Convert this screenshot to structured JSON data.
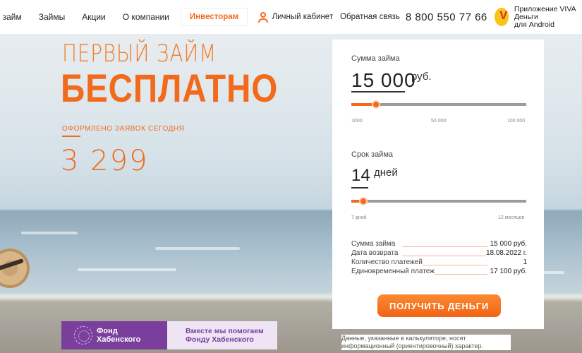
{
  "nav": {
    "items": [
      "ь займ",
      "Займы",
      "Акции",
      "О компании"
    ],
    "investors": "Инвесторам",
    "cabinet": "Личный кабинет",
    "feedback": "Обратная связь",
    "phone": "8 800 550 77 66",
    "app_logo_letter": "V",
    "app_text_line1": "Приложение VIVA Деньги",
    "app_text_line2": "для Android"
  },
  "hero": {
    "line1": "ПЕРВЫЙ ЗАЙМ",
    "line2": "БЕСПЛАТНО",
    "counter_label": "ОФОРМЛЕНО ЗАЯВОК СЕГОДНЯ",
    "counter_value": "3 299"
  },
  "calculator": {
    "amount_label": "Сумма займа",
    "amount_value": "15 000",
    "amount_unit": "руб.",
    "amount_slider_fraction": 0.14,
    "amount_ticks": [
      "1000",
      "50 000",
      "100 000"
    ],
    "term_label": "Срок займа",
    "term_value": "14",
    "term_unit": "дней",
    "term_slider_fraction": 0.07,
    "term_ticks": [
      "7 дней",
      "12 месяцев"
    ],
    "summary": [
      {
        "label": "Сумма займа",
        "value": "15 000 руб."
      },
      {
        "label": "Дата возврата",
        "value": "18.08.2022 г."
      },
      {
        "label": "Количество платежей",
        "value": "1"
      },
      {
        "label": "Единовременный платеж",
        "value": "17 100 руб."
      }
    ],
    "button": "ПОЛУЧИТЬ ДЕНЬГИ",
    "note": "Данные, указанные в калькуляторе, носят информационный (ориентировочный) характер."
  },
  "fund": {
    "name_line1": "Фонд",
    "name_line2": "Хабенского",
    "text_line1": "Вместе мы помогаем",
    "text_line2": "Фонду Хабенского"
  },
  "colors": {
    "accent": "#f26a1b",
    "fund_purple": "#7a3e9d"
  }
}
